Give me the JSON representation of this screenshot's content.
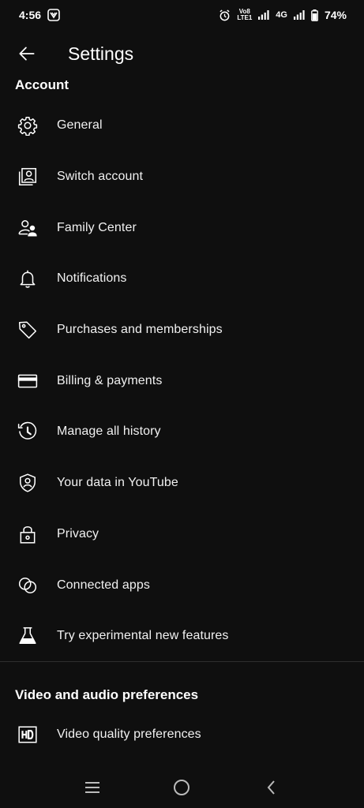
{
  "status_bar": {
    "time": "4:56",
    "volte_top": "Vo8",
    "volte_bottom": "LTE1",
    "network": "4G",
    "battery": "74%"
  },
  "app_bar": {
    "title": "Settings"
  },
  "sections": {
    "account": {
      "title": "Account",
      "items": [
        {
          "label": "General",
          "icon": "gear-icon"
        },
        {
          "label": "Switch account",
          "icon": "switch-account-icon"
        },
        {
          "label": "Family Center",
          "icon": "family-icon"
        },
        {
          "label": "Notifications",
          "icon": "bell-icon"
        },
        {
          "label": "Purchases and memberships",
          "icon": "tag-icon"
        },
        {
          "label": "Billing & payments",
          "icon": "credit-card-icon"
        },
        {
          "label": "Manage all history",
          "icon": "history-icon"
        },
        {
          "label": "Your data in YouTube",
          "icon": "shield-person-icon"
        },
        {
          "label": "Privacy",
          "icon": "lock-icon"
        },
        {
          "label": "Connected apps",
          "icon": "connected-apps-icon"
        },
        {
          "label": "Try experimental new features",
          "icon": "flask-icon"
        }
      ]
    },
    "video_audio": {
      "title": "Video and audio preferences",
      "items": [
        {
          "label": "Video quality preferences",
          "icon": "hd-icon"
        }
      ]
    }
  },
  "colors": {
    "background": "#0f0f0f",
    "text": "#f1f1f1",
    "divider": "#2e2e2e"
  }
}
